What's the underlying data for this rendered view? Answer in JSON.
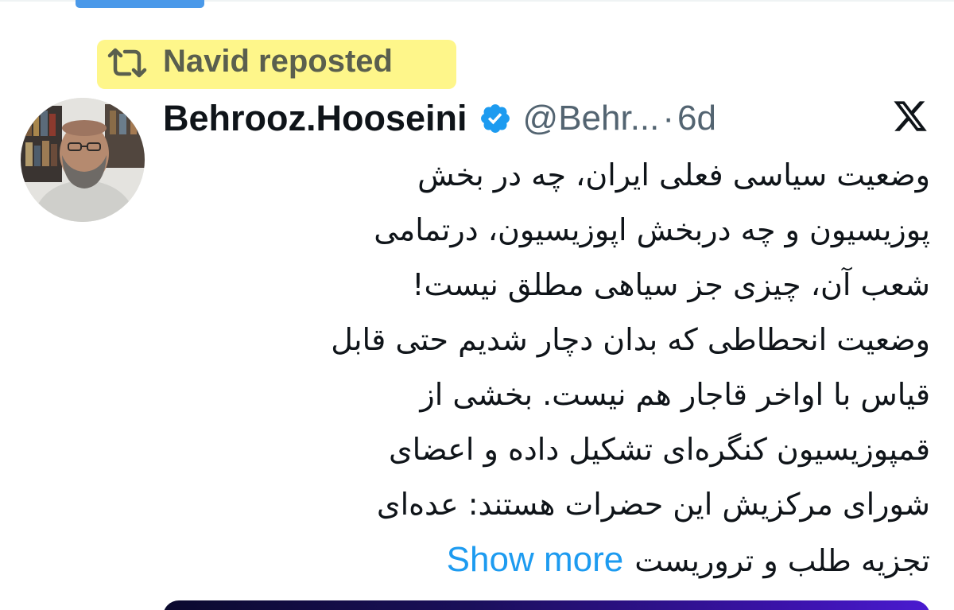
{
  "repost": {
    "label": "Navid reposted",
    "highlight_color": "#fef68a"
  },
  "author": {
    "display_name": "Behrooz.Hooseini",
    "handle": "@Behr...",
    "separator": "·",
    "timestamp": "6d",
    "verified": true,
    "verified_color": "#1d9bf0"
  },
  "tweet": {
    "lines": [
      "وضعیت سیاسی فعلی ایران، چه در بخش",
      "پوزیسیون و چه دربخش اپوزیسیون، درتمامی",
      "شعب آن، چیزی جز سیاهی مطلق نیست!",
      "وضعیت انحطاطی که بدان دچار شدیم حتی قابل",
      "قیاس با اواخر قاجار هم نیست. بخشی از",
      "قمپوزیسیون کنگره‌ای تشکیل داده و اعضای",
      "شورای مرکزیش این حضرات هستند: عده‌ای",
      "تجزیه طلب و تروریست"
    ],
    "show_more_label": "Show more",
    "link_color": "#1d9bf0"
  },
  "icons": {
    "repost": "repost-icon",
    "verified": "verified-badge-icon",
    "platform": "x-logo-icon",
    "avatar": "avatar"
  }
}
